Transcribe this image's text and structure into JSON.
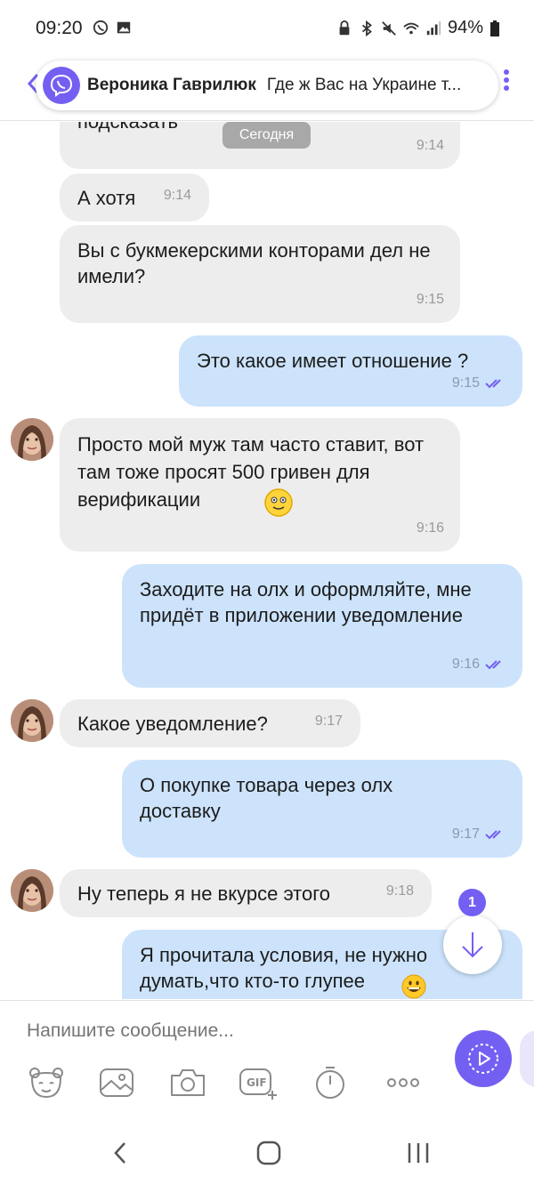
{
  "status_bar": {
    "time": "09:20",
    "battery": "94%"
  },
  "header": {
    "contact_name": "Вероника Гаврилюк",
    "last_message_snippet": "Где ж Вас на Украине т..."
  },
  "chat": {
    "date_badge": "Сегодня",
    "messages": [
      {
        "dir": "in",
        "text": "подсказать",
        "time": "9:14"
      },
      {
        "dir": "in",
        "text": "А хотя",
        "time": "9:14"
      },
      {
        "dir": "in",
        "text": "Вы с букмекерскими конторами дел не имели?",
        "time": "9:15"
      },
      {
        "dir": "out",
        "text": "Это какое имеет отношение ?",
        "time": "9:15"
      },
      {
        "dir": "in",
        "text": "Просто мой муж там часто ставит, вот там тоже просят 500 гривен для верификации",
        "time": "9:16"
      },
      {
        "dir": "out",
        "text": "Заходите на олх и оформляйте, мне придёт в приложении уведомление",
        "time": "9:16"
      },
      {
        "dir": "in",
        "text": "Какое уведомление?",
        "time": "9:17"
      },
      {
        "dir": "out",
        "text": "О покупке товара через олх доставку",
        "time": "9:17"
      },
      {
        "dir": "in",
        "text": "Ну теперь я не вкурсе этого",
        "time": "9:18"
      },
      {
        "dir": "out",
        "text": "Я прочитала условия, не нужно думать,что кто-то глупее",
        "time": ""
      }
    ],
    "unread_count": "1"
  },
  "composer": {
    "placeholder": "Напишите сообщение..."
  },
  "toolbar_icons": [
    "sticker-icon",
    "gallery-icon",
    "camera-icon",
    "gif-icon",
    "timer-icon",
    "more-icon"
  ],
  "colors": {
    "accent": "#7360f2",
    "incoming": "#ededed",
    "outgoing": "#cce3fb"
  }
}
